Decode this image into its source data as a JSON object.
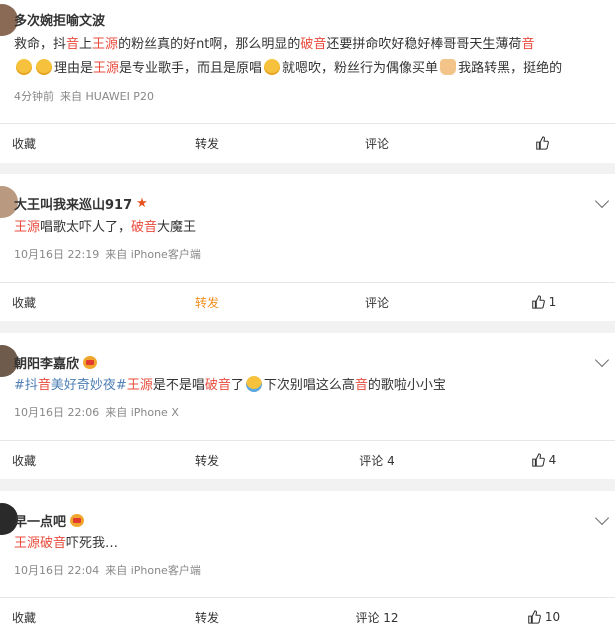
{
  "colors": {
    "accent": "#f08e1c",
    "highlight": "#e84c3d",
    "link": "#4e7fb5"
  },
  "posts": [
    {
      "name": "多次婉拒喻文波",
      "badge": "",
      "content": [
        {
          "t": "救命，抖",
          "c": ""
        },
        {
          "t": "音",
          "c": "hl"
        },
        {
          "t": "上",
          "c": ""
        },
        {
          "t": "王源",
          "c": "hl"
        },
        {
          "t": "的粉丝真的好nt啊，那么明显的",
          "c": ""
        },
        {
          "t": "破音",
          "c": "hl"
        },
        {
          "t": "还要拼命吹好稳好棒哥哥天生薄荷",
          "c": ""
        },
        {
          "t": "音",
          "c": "hl"
        }
      ],
      "content2": [
        {
          "t": "理由是",
          "c": ""
        },
        {
          "t": "王源",
          "c": "hl"
        },
        {
          "t": "是专业歌手，而且是原唱",
          "c": ""
        },
        {
          "t": "就嗯吹，粉丝行为偶像买单",
          "c": ""
        },
        {
          "t": "我路转黑，挺绝的",
          "c": ""
        }
      ],
      "time": "4分钟前",
      "source": "来自 HUAWEI P20",
      "actions": {
        "fav": "收藏",
        "share": "转发",
        "comment": "评论",
        "like": ""
      }
    },
    {
      "name": "大王叫我来巡山917",
      "badge": "star",
      "content": [
        {
          "t": "王源",
          "c": "hl"
        },
        {
          "t": "唱歌太吓人了，",
          "c": ""
        },
        {
          "t": "破音",
          "c": "hl"
        },
        {
          "t": "大魔王",
          "c": ""
        }
      ],
      "time": "10月16日 22:19",
      "source": "来自 iPhone客户端",
      "actions": {
        "fav": "收藏",
        "share": "转发",
        "comment": "评论",
        "like": "1"
      }
    },
    {
      "name": "朝阳李嘉欣",
      "badge": "crown",
      "content": [
        {
          "t": "#抖",
          "c": "tag"
        },
        {
          "t": "音",
          "c": "hl"
        },
        {
          "t": "美好奇妙夜#",
          "c": "tag"
        },
        {
          "t": "王源",
          "c": "hl"
        },
        {
          "t": "是不是唱",
          "c": ""
        },
        {
          "t": "破音",
          "c": "hl"
        },
        {
          "t": "了",
          "c": ""
        },
        {
          "t": "下次别唱这么高",
          "c": ""
        },
        {
          "t": "音",
          "c": "hl"
        },
        {
          "t": "的歌啦小小宝",
          "c": ""
        }
      ],
      "time": "10月16日 22:06",
      "source": "来自 iPhone X",
      "actions": {
        "fav": "收藏",
        "share": "转发",
        "comment": "评论 4",
        "like": "4"
      }
    },
    {
      "name": "早一点吧",
      "badge": "crown",
      "content": [
        {
          "t": "王源",
          "c": "hl"
        },
        {
          "t": "破音",
          "c": "hl"
        },
        {
          "t": "吓死我…",
          "c": ""
        }
      ],
      "time": "10月16日 22:04",
      "source": "来自 iPhone客户端",
      "actions": {
        "fav": "收藏",
        "share": "转发",
        "comment": "评论 12",
        "like": "10"
      }
    }
  ]
}
